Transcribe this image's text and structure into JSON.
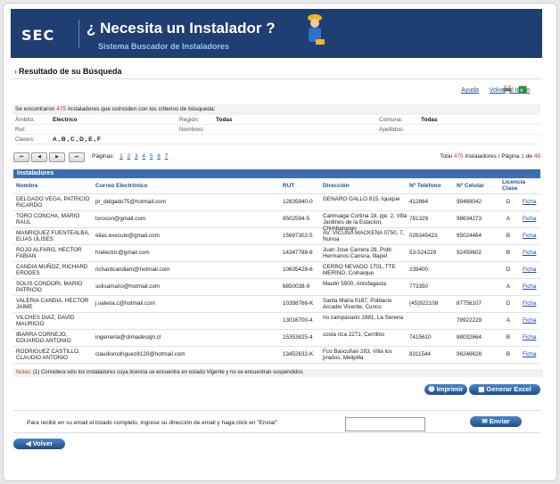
{
  "banner": {
    "logo": "SEC",
    "title": "¿ Necesita un Instalador ?",
    "subtitle": "Sistema Buscador de Instaladores"
  },
  "heading": "Resultado de su Búsqueda",
  "toplinks": {
    "help": "Ayuda",
    "back_home": "Volver al Inicio"
  },
  "criteria": {
    "found_prefix": "Se encontraron",
    "found_count": "475",
    "found_suffix": "Instaladores que coinciden con los criterios de búsqueda:",
    "ambito_label": "Ámbito:",
    "ambito": "Electrico",
    "region_label": "Región:",
    "region": "Todas",
    "comuna_label": "Comuna:",
    "comuna": "Todas",
    "rut_label": "Rut:",
    "nombres_label": "Nombres:",
    "apellidos_label": "Apellidos:",
    "clases_label": "Clases:",
    "clases": "A , B , C , D , E , F"
  },
  "pager": {
    "pages_label": "Páginas:",
    "pages": [
      "1",
      "2",
      "3",
      "4",
      "5",
      "6",
      "7"
    ],
    "total_label": "Total",
    "total_count": "475",
    "total_suffix": "Instaladores /  Página",
    "current_page": "1",
    "of_label": "de",
    "page_count": "48"
  },
  "table": {
    "title": "Instaladores",
    "columns": [
      "Nombre",
      "Correo Electrónico",
      "RUT",
      "Dirección",
      "Nº Teléfono",
      "Nº Celular",
      "Licencia Clase",
      ""
    ],
    "rows": [
      {
        "nombre": "DELGADO VEGA, PATRICIO RICARDO",
        "correo": "pr_delgado75@hotmail.com",
        "rut": "12835940-0",
        "direccion": "GENARO GALLO 815, Iquique",
        "telefono": "412864",
        "celular": "99469042",
        "clase": "D",
        "ficha": "Ficha"
      },
      {
        "nombre": "TORO CONCHA, MARIO RAUL",
        "correo": "torocon@gmail.com",
        "rut": "8502594-5",
        "direccion": "Camruaga Cortina 18, pje. 2, Villa Jardines de la Estacion, Chimbarongo",
        "telefono": "781329",
        "celular": "98634273",
        "clase": "A",
        "ficha": "Ficha"
      },
      {
        "nombre": "MANRIQUEZ FUENTEALBA, ELIAS ULISES",
        "correo": "elias.execute@gmail.com",
        "rut": "15697302-5",
        "direccion": "AV. VICUÑA MACKENA 0750, 7, Nunoa",
        "telefono": "026345423",
        "celular": "95024464",
        "clase": "B",
        "ficha": "Ficha"
      },
      {
        "nombre": "ROJO ALFARO, HECTOR FABIAN",
        "correo": "hrelectric@gmail.com",
        "rut": "14347788-6",
        "direccion": "Juan Jose Carrera 28, Pobl. Hermanos Carrera, Illapel",
        "telefono": "53-524229",
        "celular": "92459602",
        "clase": "B",
        "ficha": "Ficha"
      },
      {
        "nombre": "CANDIA MUÑOZ, RICHARD ERODES",
        "correo": "richardcandiam@hotmail.com",
        "rut": "10635428-6",
        "direccion": "CERRO NEVADO 1701, TTE MERINO, Coihaique",
        "telefono": "239400",
        "celular": "",
        "clase": "D",
        "ficha": "Ficha"
      },
      {
        "nombre": "SOLIS CONDORI, MARIO PATRICIO",
        "correo": "solisamario@hotmail.com",
        "rut": "6850038-9",
        "direccion": "Maulin 5500, Antofagasta",
        "telefono": "773350",
        "celular": "",
        "clase": "A",
        "ficha": "Ficha"
      },
      {
        "nombre": "VALERIA CANDIA, HECTOR JAIME",
        "correo": "j.valeria.c@hotmail.com",
        "rut": "10398766-K",
        "direccion": "Santa Maria 0187, Poblacio Arcadio Vicente, Cunco",
        "telefono": "(45)922108",
        "celular": "87756107",
        "clase": "D",
        "ficha": "Ficha"
      },
      {
        "nombre": "VILCHES DIAZ, DAVID MAURICIO",
        "correo": "",
        "rut": "13016700-4",
        "direccion": "rio campanario 1881, La Serena",
        "telefono": "",
        "celular": "78922229",
        "clase": "A",
        "ficha": "Ficha"
      },
      {
        "nombre": "IBARRA CORNEJO, EDUARDO ANTONIO",
        "correo": "ingenieria@climadesign.cl",
        "rut": "15353825-4",
        "direccion": "costa rica 2271, Cerrillos",
        "telefono": "7415610",
        "celular": "88032664",
        "clase": "B",
        "ficha": "Ficha"
      },
      {
        "nombre": "RODRIGUEZ CASTILLO, CLAUDIO ANTONIO",
        "correo": "claudiorodriguez8120@hotmail.com",
        "rut": "13452632-K",
        "direccion": "Fco Bascuñan 283, Villa los prados, Melipilla",
        "telefono": "8311544",
        "celular": "96246628",
        "clase": "B",
        "ficha": "Ficha"
      }
    ]
  },
  "notes": {
    "label": "Notas:",
    "text": "(1) Considera sólo los instaladores cuya licencia se encuentra en estado Vigente y no se encuentran suspendidos"
  },
  "actions": {
    "print": "Imprimir",
    "excel": "Generar Excel"
  },
  "email_panel": {
    "text": "Para recibir en su email el listado completo, ingrese su dirección de email y haga click en \"Enviar\"",
    "value": "",
    "send": "Enviar"
  },
  "back_button": "Volver",
  "colors": {
    "banner": "#1f3e72",
    "accent": "#c0392b",
    "header_bar": "#3a6fb0",
    "link": "#1f4e9c"
  }
}
